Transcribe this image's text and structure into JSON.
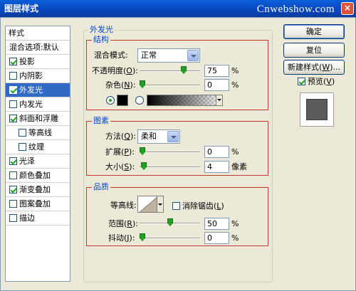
{
  "window": {
    "title": "图层样式",
    "watermark": "Cnwebshow.com",
    "close_glyph": "×"
  },
  "style_list": {
    "header": "样式",
    "items": [
      {
        "label": "混合选项:默认",
        "checkbox": false,
        "checked": false,
        "selected": false,
        "indent": false
      },
      {
        "label": "投影",
        "checkbox": true,
        "checked": true,
        "selected": false,
        "indent": false
      },
      {
        "label": "内阴影",
        "checkbox": true,
        "checked": false,
        "selected": false,
        "indent": false
      },
      {
        "label": "外发光",
        "checkbox": true,
        "checked": true,
        "selected": true,
        "indent": false
      },
      {
        "label": "内发光",
        "checkbox": true,
        "checked": false,
        "selected": false,
        "indent": false
      },
      {
        "label": "斜面和浮雕",
        "checkbox": true,
        "checked": true,
        "selected": false,
        "indent": false
      },
      {
        "label": "等高线",
        "checkbox": true,
        "checked": false,
        "selected": false,
        "indent": true
      },
      {
        "label": "纹理",
        "checkbox": true,
        "checked": false,
        "selected": false,
        "indent": true
      },
      {
        "label": "光泽",
        "checkbox": true,
        "checked": true,
        "selected": false,
        "indent": false
      },
      {
        "label": "颜色叠加",
        "checkbox": true,
        "checked": false,
        "selected": false,
        "indent": false
      },
      {
        "label": "渐变叠加",
        "checkbox": true,
        "checked": true,
        "selected": false,
        "indent": false
      },
      {
        "label": "图案叠加",
        "checkbox": true,
        "checked": false,
        "selected": false,
        "indent": false
      },
      {
        "label": "描边",
        "checkbox": true,
        "checked": false,
        "selected": false,
        "indent": false
      }
    ]
  },
  "outer_glow": {
    "title": "外发光",
    "structure": {
      "title": "结构",
      "blend_mode_label": "混合模式:",
      "blend_mode_value": "正常",
      "opacity_label": "不透明度(",
      "opacity_key": "O",
      "opacity_label_end": "):",
      "opacity_value": "75",
      "opacity_slider": 0.75,
      "noise_label": "杂色(",
      "noise_key": "N",
      "noise_label_end": "):",
      "noise_value": "0",
      "noise_slider": 0,
      "unit": "%",
      "color_mode": "solid",
      "solid_color": "#000000"
    },
    "elements": {
      "title": "图素",
      "technique_label": "方法(",
      "technique_key": "Q",
      "technique_label_end": "):",
      "technique_value": "柔和",
      "spread_label": "扩展(",
      "spread_key": "P",
      "spread_label_end": "):",
      "spread_value": "0",
      "spread_slider": 0,
      "spread_unit": "%",
      "size_label": "大小(",
      "size_key": "S",
      "size_label_end": "):",
      "size_value": "4",
      "size_slider": 0.02,
      "size_unit": "像素"
    },
    "quality": {
      "title": "品质",
      "contour_label": "等高线:",
      "antialias_label": "消除锯齿(",
      "antialias_key": "L",
      "antialias_label_end": ")",
      "antialias_checked": false,
      "range_label": "范围(",
      "range_key": "R",
      "range_label_end": "):",
      "range_value": "50",
      "range_slider": 0.5,
      "jitter_label": "抖动(",
      "jitter_key": "J",
      "jitter_label_end": "):",
      "jitter_value": "0",
      "jitter_slider": 0,
      "unit": "%"
    }
  },
  "buttons": {
    "ok": "确定",
    "reset": "复位",
    "new_style": "新建样式(",
    "new_style_key": "W",
    "new_style_end": ")...",
    "preview_label": "预览(",
    "preview_key": "V",
    "preview_end": ")",
    "preview_checked": true
  },
  "colors": {
    "accent": "#316ac5",
    "group_title": "#0046d5",
    "highlight_box": "#c0392b",
    "slider_thumb": "#21a121"
  }
}
